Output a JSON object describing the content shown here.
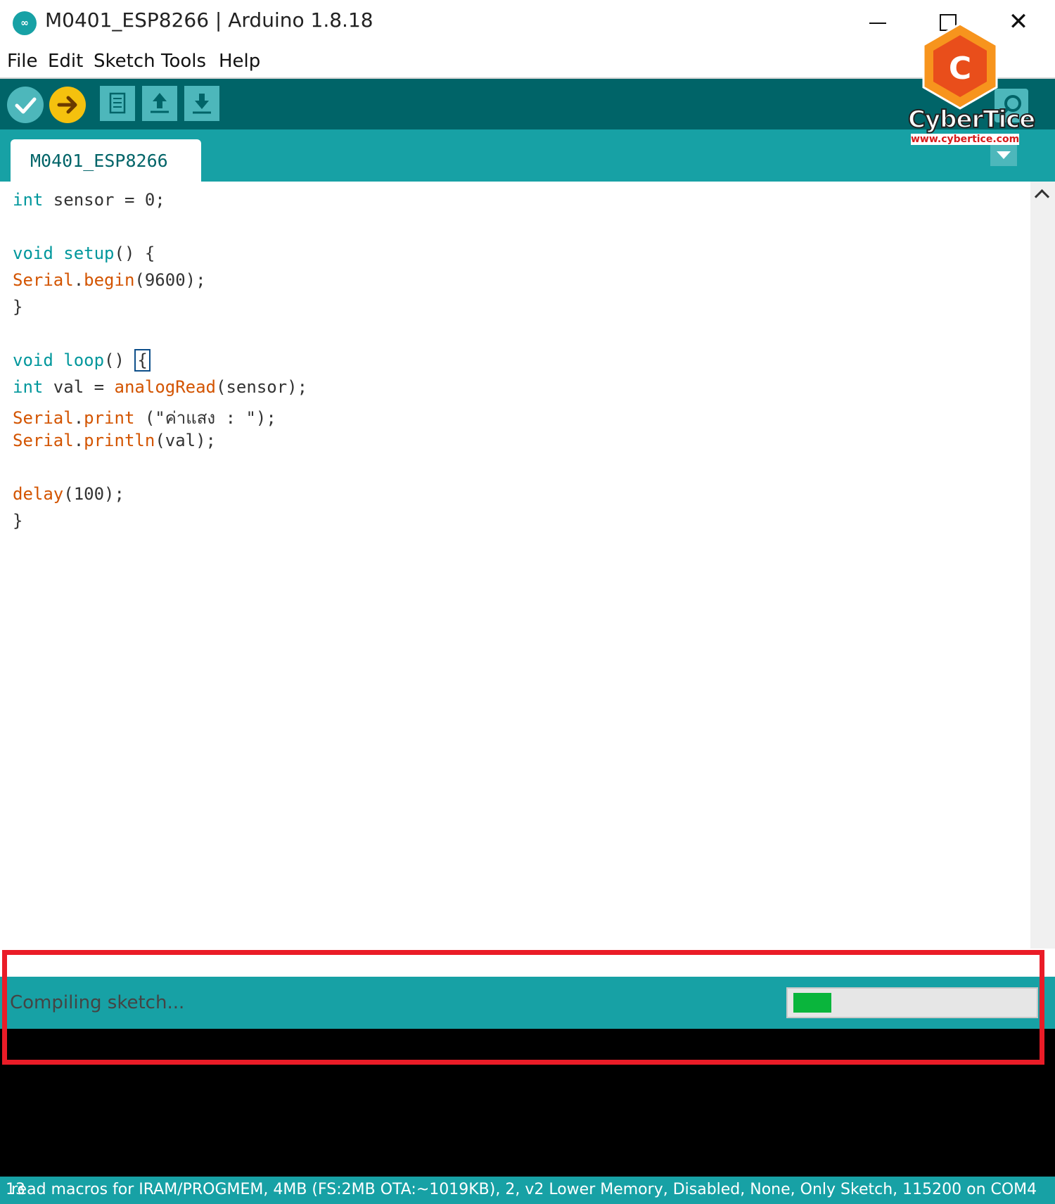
{
  "window": {
    "title": "M0401_ESP8266 | Arduino 1.8.18",
    "app_icon": "arduino-infinity-icon",
    "close_glyph": "✕"
  },
  "menu": [
    "File",
    "Edit",
    "Sketch",
    "Tools",
    "Help"
  ],
  "toolbar": {
    "icons": [
      "verify-check-icon",
      "upload-arrow-icon",
      "new-file-icon",
      "open-up-arrow-icon",
      "save-down-arrow-icon",
      "serial-monitor-icon"
    ]
  },
  "tab": {
    "label": "M0401_ESP8266"
  },
  "code": [
    [
      [
        "kw",
        "int"
      ],
      [
        "t",
        " sensor = 0;"
      ]
    ],
    [],
    [
      [
        "kw",
        "void"
      ],
      [
        "t",
        " "
      ],
      [
        "kw",
        "setup"
      ],
      [
        "t",
        "() {"
      ]
    ],
    [
      [
        "fn",
        "Serial"
      ],
      [
        "t",
        "."
      ],
      [
        "fn",
        "begin"
      ],
      [
        "t",
        "(9600);"
      ]
    ],
    [
      [
        "t",
        "}"
      ]
    ],
    [],
    [
      [
        "kw",
        "void"
      ],
      [
        "t",
        " "
      ],
      [
        "kw",
        "loop"
      ],
      [
        "t",
        "() "
      ],
      [
        "cur",
        "{"
      ]
    ],
    [
      [
        "kw",
        "int"
      ],
      [
        "t",
        " val = "
      ],
      [
        "fn",
        "analogRead"
      ],
      [
        "t",
        "(sensor);"
      ]
    ],
    [
      [
        "fn",
        "Serial"
      ],
      [
        "t",
        "."
      ],
      [
        "fn",
        "print"
      ],
      [
        "t",
        " (\"ค่าแสง : \");"
      ]
    ],
    [
      [
        "fn",
        "Serial"
      ],
      [
        "t",
        "."
      ],
      [
        "fn",
        "println"
      ],
      [
        "t",
        "(val);"
      ]
    ],
    [],
    [
      [
        "fn",
        "delay"
      ],
      [
        "t",
        "(100);"
      ]
    ],
    [
      [
        "t",
        "}"
      ]
    ]
  ],
  "status": {
    "message": "Compiling sketch...",
    "progress_fraction": 0.16
  },
  "footer": {
    "line_number": "13",
    "board": "read macros for IRAM/PROGMEM, 4MB (FS:2MB OTA:~1019KB), 2, v2 Lower Memory, Disabled, None, Only Sketch, 115200 on COM4"
  },
  "watermark": {
    "brand": "CyberTice",
    "url": "www.cybertice.com",
    "letter": "C"
  },
  "colors": {
    "toolbar": "#006468",
    "tabstrip": "#17a1a5",
    "keyword": "#00979c",
    "function": "#d35400",
    "highlight": "#ea1c27",
    "progress": "#0ab53c"
  }
}
